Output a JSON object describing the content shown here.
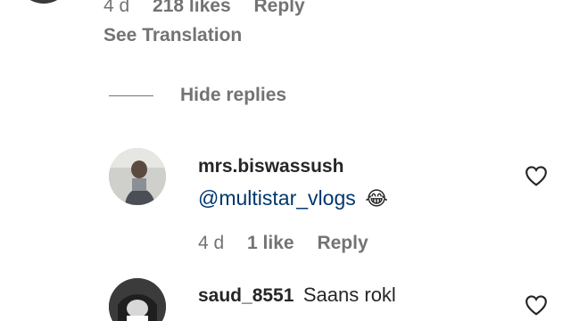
{
  "parent_comment": {
    "time": "4 d",
    "likes": "218 likes",
    "reply_label": "Reply",
    "see_translation": "See Translation"
  },
  "replies_toggle": {
    "label": "Hide replies"
  },
  "replies": [
    {
      "username": "mrs.biswassush",
      "mention": "@multistar_vlogs",
      "emoji": "😂",
      "time": "4 d",
      "likes": "1 like",
      "reply_label": "Reply",
      "like_icon": "heart-outline-icon"
    },
    {
      "username": "saud_8551",
      "text": "Saans rokl",
      "like_icon": "heart-outline-icon"
    }
  ]
}
